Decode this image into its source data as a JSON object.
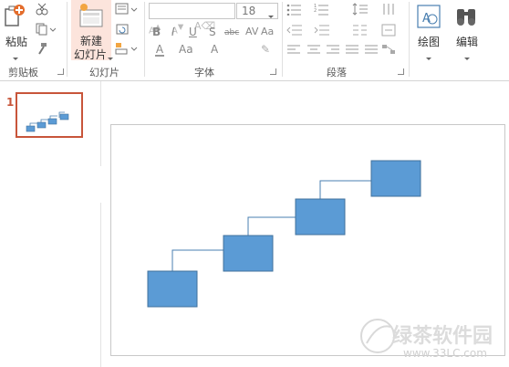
{
  "ribbon": {
    "clipboard": {
      "paste_label": "粘贴",
      "group_label": "剪贴板"
    },
    "slides": {
      "new_slide_line1": "新建",
      "new_slide_line2": "幻灯片",
      "group_label": "幻灯片"
    },
    "font": {
      "size_value": "18",
      "group_label": "字体"
    },
    "paragraph": {
      "group_label": "段落"
    },
    "drawing": {
      "label": "绘图"
    },
    "editing": {
      "label": "编辑"
    }
  },
  "thumbnails": [
    {
      "number": "1"
    }
  ],
  "watermark": {
    "title": "绿茶软件园",
    "url": "www.33LC.com"
  },
  "colors": {
    "shape_fill": "#5b9bd5",
    "shape_stroke": "#41719c",
    "connector": "#4a7fb0",
    "selected_border": "#c8553a"
  }
}
